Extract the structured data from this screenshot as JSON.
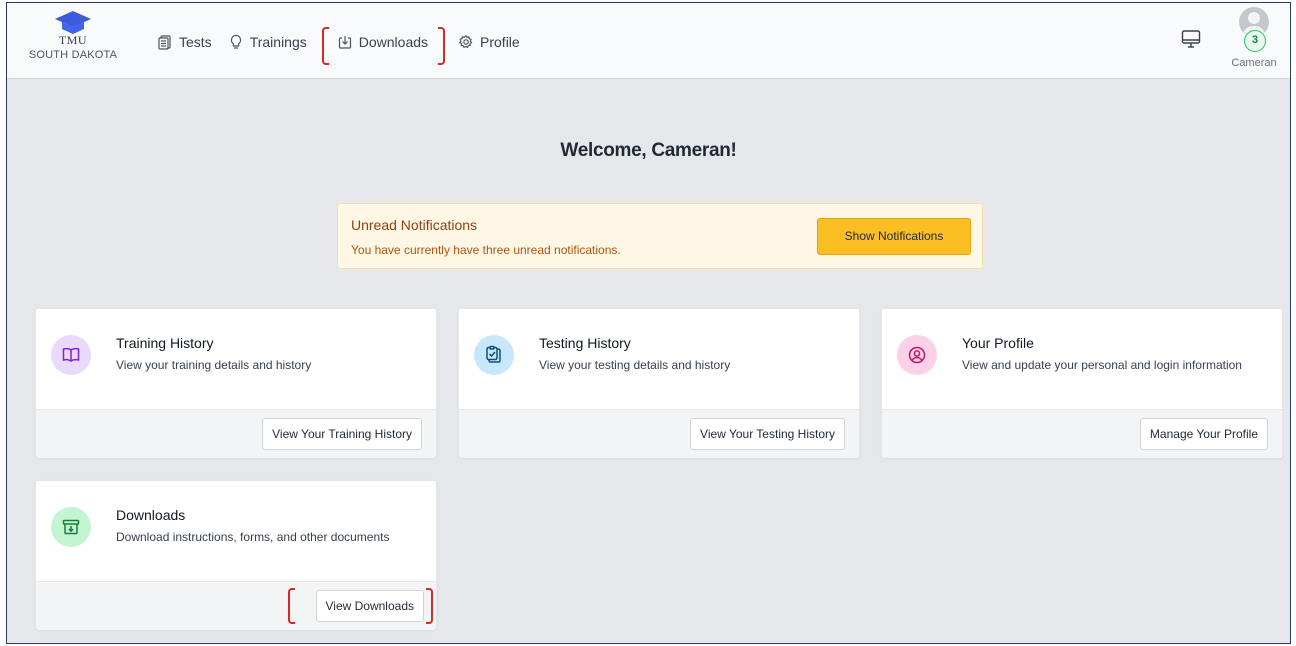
{
  "brand": {
    "name": "TMU",
    "subtitle": "SOUTH DAKOTA"
  },
  "nav": [
    {
      "label": "Tests",
      "icon": "document-list-icon"
    },
    {
      "label": "Trainings",
      "icon": "lightbulb-icon"
    },
    {
      "label": "Downloads",
      "icon": "download-icon"
    },
    {
      "label": "Profile",
      "icon": "gear-icon"
    }
  ],
  "user": {
    "name": "Cameran",
    "notification_count": "3"
  },
  "welcome": "Welcome, Cameran!",
  "notice": {
    "title": "Unread Notifications",
    "text": "You have currently have three unread notifications.",
    "button": "Show Notifications"
  },
  "cards": [
    {
      "title": "Training History",
      "desc": "View your training details and history",
      "button": "View Your Training History",
      "icon": "book-icon",
      "color": "#e9d5ff"
    },
    {
      "title": "Testing History",
      "desc": "View your testing details and history",
      "button": "View Your Testing History",
      "icon": "clipboard-check-icon",
      "color": "#bae6fd"
    },
    {
      "title": "Your Profile",
      "desc": "View and update your personal and login information",
      "button": "Manage Your Profile",
      "icon": "user-circle-icon",
      "color": "#fbcfe8"
    },
    {
      "title": "Downloads",
      "desc": "Download instructions, forms, and other documents",
      "button": "View Downloads",
      "icon": "archive-download-icon",
      "color": "#bbf7d0"
    }
  ],
  "colors": {
    "accent": "#fbbf24",
    "highlight": "#dc2626",
    "background": "#e5e7eb"
  }
}
